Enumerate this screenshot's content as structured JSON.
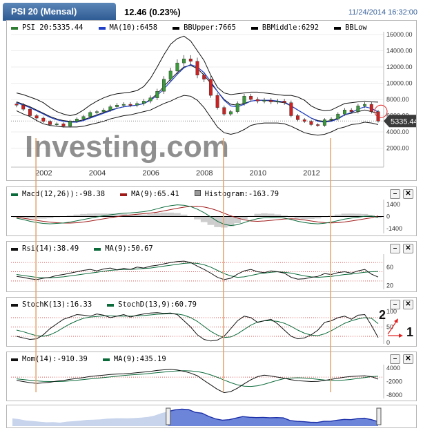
{
  "header": {
    "title": "PSI 20 (Mensal)",
    "price": "12.46 (0.23%)",
    "timestamp": "11/24/2014 16:32:00"
  },
  "main_panel": {
    "legend": [
      {
        "label": "PSI 20:5335.44",
        "color": "#2e7d32"
      },
      {
        "label": "MA(10):6458",
        "color": "#1f3fc8"
      },
      {
        "label": "BBUpper:7665",
        "color": "#000000"
      },
      {
        "label": "BBMiddle:6292",
        "color": "#000000"
      },
      {
        "label": "BBLow",
        "color": "#000000"
      }
    ],
    "current_price_label": "5335.44",
    "watermark": "Investing.com"
  },
  "macd_panel": {
    "legend": [
      {
        "label": "Macd(12,26)):-98.38",
        "color": "#0b6a3a"
      },
      {
        "label": "MA(9):65.41",
        "color": "#a01a1a"
      },
      {
        "label": "Histogram:-163.79",
        "color": "#999999",
        "square": true
      }
    ]
  },
  "rsi_panel": {
    "legend": [
      {
        "label": "Rsi(14):38.49",
        "color": "#111111"
      },
      {
        "label": "MA(9):50.67",
        "color": "#0b6a3a"
      }
    ]
  },
  "stoch_panel": {
    "legend": [
      {
        "label": "StochK(13):16.33",
        "color": "#111111"
      },
      {
        "label": "StochD(13,9):60.79",
        "color": "#0b6a3a"
      }
    ],
    "annotations": [
      "2",
      "1"
    ]
  },
  "mom_panel": {
    "legend": [
      {
        "label": "Mom(14):-910.39",
        "color": "#111111"
      },
      {
        "label": "MA(9):435.19",
        "color": "#0b6a3a"
      }
    ]
  },
  "controls": {
    "minimize": "–",
    "close": "✕"
  },
  "colors": {
    "up": "#3a9a3a",
    "down": "#cc2222",
    "ma": "#1f3fc8",
    "bb": "#111111",
    "signal": "#0b6a3a",
    "ref": "#e05050"
  },
  "chart_data": [
    {
      "type": "candlestick",
      "title": "PSI 20 (Mensal)",
      "x": [
        "2001-05",
        "2001-08",
        "2001-11",
        "2002-02",
        "2002-05",
        "2002-08",
        "2002-11",
        "2003-02",
        "2003-05",
        "2003-08",
        "2003-11",
        "2004-02",
        "2004-05",
        "2004-08",
        "2004-11",
        "2005-02",
        "2005-05",
        "2005-08",
        "2005-11",
        "2006-02",
        "2006-05",
        "2006-08",
        "2006-11",
        "2007-02",
        "2007-05",
        "2007-08",
        "2007-11",
        "2008-02",
        "2008-05",
        "2008-08",
        "2008-11",
        "2009-02",
        "2009-05",
        "2009-08",
        "2009-11",
        "2010-02",
        "2010-05",
        "2010-08",
        "2010-11",
        "2011-02",
        "2011-05",
        "2011-08",
        "2011-11",
        "2012-02",
        "2012-05",
        "2012-08",
        "2012-11",
        "2013-02",
        "2013-05",
        "2013-08",
        "2013-11",
        "2014-02",
        "2014-05",
        "2014-08",
        "2014-11"
      ],
      "close": [
        7300,
        6800,
        6000,
        5700,
        5300,
        4900,
        5000,
        4700,
        5300,
        5600,
        5900,
        6400,
        6500,
        6700,
        7100,
        7300,
        7400,
        7300,
        7500,
        7800,
        8200,
        9000,
        10500,
        11500,
        12500,
        13000,
        12700,
        11000,
        10500,
        8500,
        7000,
        6200,
        6500,
        7500,
        8400,
        8000,
        7800,
        7900,
        7700,
        7800,
        7600,
        6000,
        5500,
        5300,
        4900,
        4800,
        5500,
        5600,
        6200,
        6700,
        6500,
        7200,
        7400,
        6500,
        5335.44
      ],
      "ma10": [
        7600,
        7300,
        7000,
        6600,
        6200,
        5800,
        5500,
        5300,
        5200,
        5200,
        5400,
        5700,
        6000,
        6300,
        6600,
        6900,
        7100,
        7200,
        7300,
        7500,
        7900,
        8500,
        9300,
        10200,
        11100,
        11900,
        12300,
        12000,
        11300,
        10200,
        9000,
        7900,
        7200,
        7100,
        7400,
        7800,
        7900,
        7900,
        7900,
        7800,
        7700,
        7200,
        6700,
        6200,
        5700,
        5300,
        5200,
        5300,
        5600,
        6100,
        6400,
        6800,
        7100,
        6900,
        6458
      ],
      "bb_upper": [
        8800,
        8600,
        8300,
        8000,
        7600,
        7000,
        6500,
        6200,
        6000,
        6200,
        6700,
        7300,
        7800,
        8200,
        8500,
        8700,
        8800,
        8900,
        9100,
        9600,
        10600,
        12000,
        13500,
        14800,
        15500,
        15800,
        15200,
        14000,
        12800,
        11000,
        9500,
        8800,
        8600,
        8700,
        8800,
        8900,
        8900,
        8800,
        8700,
        8600,
        8500,
        8500,
        8300,
        7900,
        7200,
        6800,
        6600,
        6700,
        7100,
        7500,
        7600,
        7700,
        7800,
        7700,
        7665
      ],
      "bb_middle": [
        7700,
        7400,
        7100,
        6700,
        6300,
        5900,
        5600,
        5400,
        5300,
        5300,
        5500,
        5800,
        6100,
        6400,
        6700,
        6900,
        7100,
        7200,
        7300,
        7500,
        8000,
        8700,
        9600,
        10500,
        11300,
        12000,
        12200,
        11800,
        11000,
        10000,
        9000,
        8000,
        7400,
        7300,
        7500,
        7800,
        7900,
        7900,
        7800,
        7700,
        7600,
        7200,
        6700,
        6200,
        5700,
        5400,
        5300,
        5400,
        5700,
        6100,
        6300,
        6500,
        6700,
        6500,
        6292
      ],
      "bb_low": [
        6600,
        6200,
        5900,
        5400,
        5000,
        4800,
        4700,
        4600,
        4600,
        4600,
        4700,
        4900,
        5100,
        5300,
        5600,
        5800,
        6000,
        6100,
        6300,
        6500,
        6700,
        7100,
        7500,
        7800,
        8200,
        8500,
        8400,
        7900,
        7000,
        5800,
        4600,
        3900,
        3700,
        3900,
        4300,
        4800,
        5000,
        5100,
        5100,
        5100,
        5000,
        4700,
        4300,
        3900,
        3700,
        3600,
        3700,
        4000,
        4400,
        4600,
        4900,
        5000,
        5200,
        5100,
        4900
      ],
      "ylim": [
        0,
        16000
      ],
      "y_ticks": [
        "2000.00",
        "4000.00",
        "6000.00",
        "8000.00",
        "10000.00",
        "12000.00",
        "14000.00",
        "16000.00"
      ],
      "x_ticks": [
        "2002",
        "2004",
        "2006",
        "2008",
        "2010",
        "2012"
      ]
    },
    {
      "type": "line",
      "series": [
        {
          "name": "Macd(12,26))",
          "values": [
            -200,
            -350,
            -550,
            -700,
            -800,
            -850,
            -800,
            -750,
            -650,
            -500,
            -350,
            -200,
            -50,
            80,
            200,
            300,
            380,
            420,
            480,
            560,
            700,
            900,
            1100,
            1250,
            1350,
            1300,
            1150,
            850,
            450,
            -50,
            -550,
            -900,
            -1050,
            -950,
            -700,
            -450,
            -250,
            -150,
            -120,
            -130,
            -180,
            -350,
            -550,
            -700,
            -800,
            -850,
            -780,
            -650,
            -480,
            -300,
            -180,
            -80,
            20,
            40,
            -98.38
          ]
        },
        {
          "name": "MA(9)",
          "values": [
            -100,
            -200,
            -320,
            -450,
            -560,
            -650,
            -720,
            -760,
            -760,
            -720,
            -640,
            -530,
            -400,
            -270,
            -140,
            -20,
            90,
            180,
            260,
            330,
            400,
            500,
            650,
            800,
            950,
            1080,
            1170,
            1180,
            1100,
            930,
            680,
            380,
            80,
            -180,
            -380,
            -520,
            -560,
            -520,
            -450,
            -370,
            -290,
            -260,
            -300,
            -400,
            -520,
            -630,
            -710,
            -740,
            -710,
            -630,
            -520,
            -400,
            -270,
            -150,
            65.41
          ]
        },
        {
          "name": "Histogram",
          "values": [
            -100,
            -150,
            -230,
            -250,
            -240,
            -200,
            -80,
            10,
            110,
            220,
            290,
            330,
            350,
            350,
            340,
            320,
            290,
            240,
            220,
            230,
            300,
            400,
            450,
            450,
            400,
            220,
            -20,
            -330,
            -650,
            -980,
            -1230,
            -1280,
            -1130,
            -770,
            -320,
            70,
            310,
            370,
            330,
            240,
            110,
            -90,
            -250,
            -300,
            -280,
            -220,
            -70,
            90,
            230,
            330,
            340,
            320,
            290,
            190,
            -163.79
          ]
        }
      ],
      "y_ticks": [
        "-1400",
        "0",
        "1400"
      ]
    },
    {
      "type": "line",
      "series": [
        {
          "name": "Rsi(14)",
          "values": [
            40,
            38,
            35,
            33,
            36,
            38,
            42,
            44,
            47,
            50,
            53,
            55,
            52,
            56,
            58,
            54,
            57,
            55,
            60,
            58,
            62,
            64,
            67,
            70,
            72,
            73,
            70,
            62,
            55,
            47,
            38,
            33,
            36,
            45,
            52,
            55,
            50,
            48,
            52,
            50,
            47,
            38,
            34,
            35,
            38,
            40,
            46,
            44,
            48,
            50,
            47,
            52,
            55,
            45,
            38.49
          ]
        },
        {
          "name": "MA(9)",
          "values": [
            44,
            42,
            40,
            38,
            37,
            37,
            38,
            39,
            41,
            43,
            45,
            47,
            49,
            51,
            53,
            54,
            55,
            55,
            56,
            57,
            58,
            60,
            62,
            64,
            66,
            68,
            69,
            68,
            65,
            60,
            53,
            46,
            41,
            38,
            39,
            42,
            45,
            47,
            49,
            50,
            49,
            47,
            44,
            41,
            39,
            38,
            39,
            40,
            42,
            44,
            45,
            47,
            49,
            50,
            50.67
          ]
        }
      ],
      "y_ticks": [
        "20",
        "60"
      ]
    },
    {
      "type": "line",
      "series": [
        {
          "name": "StochK(13)",
          "values": [
            20,
            15,
            10,
            12,
            25,
            45,
            60,
            75,
            82,
            90,
            88,
            85,
            92,
            88,
            80,
            85,
            90,
            82,
            88,
            92,
            95,
            96,
            94,
            95,
            90,
            70,
            50,
            25,
            10,
            5,
            8,
            20,
            45,
            70,
            85,
            80,
            65,
            70,
            75,
            60,
            40,
            20,
            12,
            15,
            25,
            40,
            65,
            70,
            80,
            85,
            75,
            88,
            90,
            55,
            16.33
          ]
        },
        {
          "name": "StochD(13,9)",
          "values": [
            40,
            35,
            28,
            22,
            20,
            25,
            35,
            48,
            60,
            70,
            78,
            82,
            84,
            86,
            86,
            85,
            85,
            85,
            86,
            87,
            89,
            91,
            92,
            93,
            92,
            88,
            80,
            68,
            52,
            36,
            24,
            16,
            18,
            28,
            42,
            56,
            66,
            70,
            70,
            68,
            62,
            52,
            40,
            30,
            24,
            22,
            28,
            38,
            50,
            62,
            70,
            76,
            80,
            78,
            60.79
          ]
        }
      ],
      "ylim": [
        0,
        100
      ],
      "y_ticks": [
        "0",
        "50",
        "100"
      ]
    },
    {
      "type": "line",
      "series": [
        {
          "name": "Mom(14)",
          "values": [
            -1500,
            -2000,
            -2500,
            -2800,
            -2600,
            -2300,
            -1800,
            -1500,
            -1000,
            -600,
            -200,
            300,
            600,
            900,
            1200,
            1400,
            1500,
            1700,
            2000,
            2300,
            2600,
            3000,
            3300,
            3500,
            3200,
            2600,
            1800,
            600,
            -1500,
            -3500,
            -5500,
            -7000,
            -6500,
            -5000,
            -3000,
            -1200,
            200,
            900,
            500,
            0,
            -500,
            -1200,
            -1600,
            -1800,
            -2000,
            -1900,
            -1500,
            -1000,
            -500,
            0,
            300,
            500,
            600,
            200,
            -910.39
          ]
        },
        {
          "name": "MA(9)",
          "values": [
            -800,
            -1100,
            -1400,
            -1700,
            -1900,
            -2000,
            -2000,
            -1900,
            -1700,
            -1400,
            -1100,
            -800,
            -500,
            -200,
            100,
            400,
            700,
            1000,
            1200,
            1400,
            1700,
            2000,
            2300,
            2600,
            2800,
            2900,
            2800,
            2500,
            1900,
            1000,
            -100,
            -1300,
            -2500,
            -3500,
            -4100,
            -4200,
            -3900,
            -3200,
            -2300,
            -1400,
            -700,
            -400,
            -300,
            -400,
            -700,
            -1000,
            -1300,
            -1500,
            -1500,
            -1300,
            -1000,
            -600,
            -200,
            200,
            435.19
          ]
        }
      ],
      "y_ticks": [
        "-8000",
        "-2000",
        "4000"
      ]
    }
  ]
}
